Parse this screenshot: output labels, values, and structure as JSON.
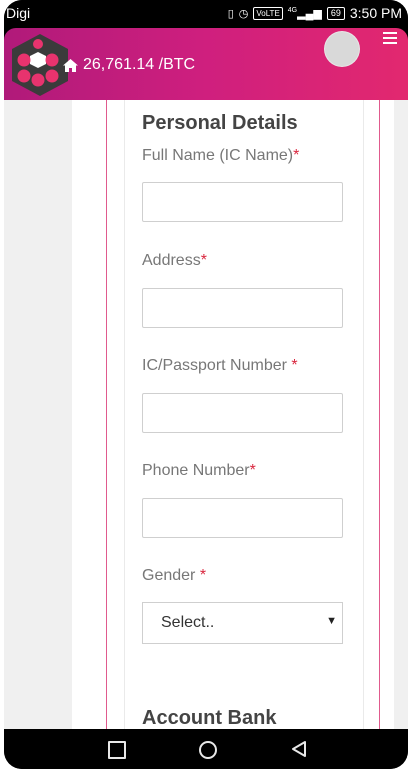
{
  "status_bar": {
    "carrier": "Digi",
    "network_badge": "VoLTE",
    "network_type": "4G",
    "battery": "69",
    "time": "3:50 PM"
  },
  "header": {
    "price_text": "26,761.14 /BTC",
    "icons": [
      "home-icon",
      "avatar",
      "hamburger-menu-icon",
      "app-logo"
    ]
  },
  "form": {
    "section_title": "Personal Details",
    "fields": [
      {
        "label": "Full Name (IC Name)",
        "required_mark": "*",
        "value": ""
      },
      {
        "label": "Address",
        "required_mark": "*",
        "value": ""
      },
      {
        "label": "IC/Passport Number ",
        "required_mark": "*",
        "value": ""
      },
      {
        "label": "Phone Number",
        "required_mark": "*",
        "value": ""
      }
    ],
    "gender": {
      "label": "Gender ",
      "required_mark": "*",
      "selected": "Select.."
    },
    "next_section_title": "Account Bank"
  },
  "colors": {
    "header_start": "#b01a7a",
    "header_end": "#e2286f",
    "required": "#d9263e",
    "accent_line": "#e05a8d"
  }
}
